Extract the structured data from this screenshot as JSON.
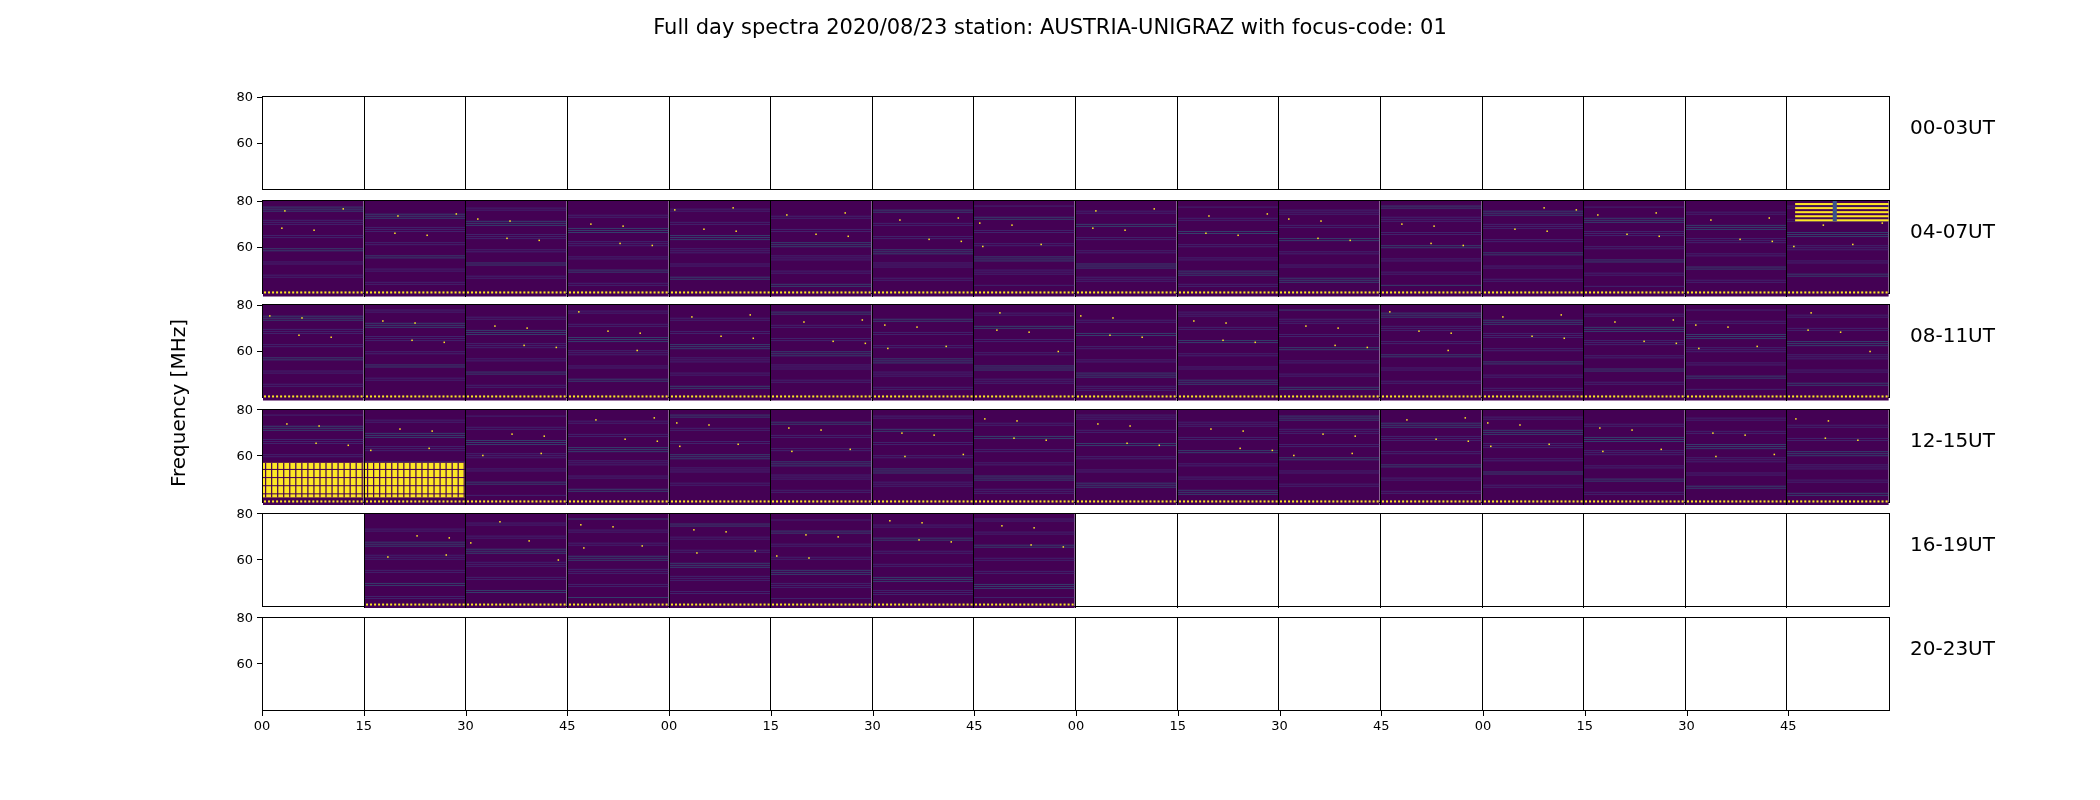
{
  "title": "Full day spectra 2020/08/23 station: AUSTRIA-UNIGRAZ with focus-code: 01",
  "ylabel": "Frequency [MHz]",
  "xticks": [
    "00",
    "15",
    "30",
    "45",
    "00",
    "15",
    "30",
    "45",
    "00",
    "15",
    "30",
    "45",
    "00",
    "15",
    "30",
    "45"
  ],
  "rows": [
    {
      "label": "00-03UT",
      "yticks": [
        "80",
        "60"
      ],
      "panels": [
        {
          "kind": "empty"
        },
        {
          "kind": "empty"
        },
        {
          "kind": "empty"
        },
        {
          "kind": "empty"
        },
        {
          "kind": "empty"
        },
        {
          "kind": "empty"
        },
        {
          "kind": "empty"
        },
        {
          "kind": "empty"
        },
        {
          "kind": "empty"
        },
        {
          "kind": "empty"
        },
        {
          "kind": "empty"
        },
        {
          "kind": "empty"
        },
        {
          "kind": "empty"
        },
        {
          "kind": "empty"
        },
        {
          "kind": "empty"
        },
        {
          "kind": "empty"
        }
      ]
    },
    {
      "label": "04-07UT",
      "yticks": [
        "80",
        "60"
      ],
      "panels": [
        {
          "kind": "spectrum"
        },
        {
          "kind": "spectrum"
        },
        {
          "kind": "spectrum"
        },
        {
          "kind": "spectrum"
        },
        {
          "kind": "spectrum"
        },
        {
          "kind": "spectrum"
        },
        {
          "kind": "spectrum"
        },
        {
          "kind": "spectrum"
        },
        {
          "kind": "spectrum"
        },
        {
          "kind": "spectrum"
        },
        {
          "kind": "spectrum"
        },
        {
          "kind": "spectrum"
        },
        {
          "kind": "spectrum"
        },
        {
          "kind": "spectrum"
        },
        {
          "kind": "spectrum"
        },
        {
          "kind": "saturated-high"
        }
      ]
    },
    {
      "label": "08-11UT",
      "yticks": [
        "80",
        "60"
      ],
      "panels": [
        {
          "kind": "spectrum"
        },
        {
          "kind": "spectrum"
        },
        {
          "kind": "spectrum"
        },
        {
          "kind": "spectrum"
        },
        {
          "kind": "spectrum"
        },
        {
          "kind": "spectrum"
        },
        {
          "kind": "spectrum"
        },
        {
          "kind": "spectrum"
        },
        {
          "kind": "spectrum"
        },
        {
          "kind": "spectrum"
        },
        {
          "kind": "spectrum"
        },
        {
          "kind": "spectrum"
        },
        {
          "kind": "spectrum"
        },
        {
          "kind": "spectrum"
        },
        {
          "kind": "spectrum"
        },
        {
          "kind": "spectrum"
        }
      ]
    },
    {
      "label": "12-15UT",
      "yticks": [
        "80",
        "60"
      ],
      "panels": [
        {
          "kind": "saturated-low"
        },
        {
          "kind": "saturated-low"
        },
        {
          "kind": "spectrum"
        },
        {
          "kind": "spectrum"
        },
        {
          "kind": "spectrum"
        },
        {
          "kind": "spectrum"
        },
        {
          "kind": "spectrum"
        },
        {
          "kind": "spectrum"
        },
        {
          "kind": "spectrum"
        },
        {
          "kind": "spectrum"
        },
        {
          "kind": "spectrum"
        },
        {
          "kind": "spectrum"
        },
        {
          "kind": "spectrum"
        },
        {
          "kind": "spectrum"
        },
        {
          "kind": "spectrum"
        },
        {
          "kind": "spectrum"
        }
      ]
    },
    {
      "label": "16-19UT",
      "yticks": [
        "80",
        "60"
      ],
      "panels": [
        {
          "kind": "empty"
        },
        {
          "kind": "spectrum"
        },
        {
          "kind": "spectrum"
        },
        {
          "kind": "spectrum"
        },
        {
          "kind": "spectrum"
        },
        {
          "kind": "spectrum"
        },
        {
          "kind": "spectrum"
        },
        {
          "kind": "spectrum"
        },
        {
          "kind": "empty"
        },
        {
          "kind": "empty"
        },
        {
          "kind": "empty"
        },
        {
          "kind": "empty"
        },
        {
          "kind": "empty"
        },
        {
          "kind": "empty"
        },
        {
          "kind": "empty"
        },
        {
          "kind": "empty"
        }
      ]
    },
    {
      "label": "20-23UT",
      "yticks": [
        "80",
        "60"
      ],
      "panels": [
        {
          "kind": "empty"
        },
        {
          "kind": "empty"
        },
        {
          "kind": "empty"
        },
        {
          "kind": "empty"
        },
        {
          "kind": "empty"
        },
        {
          "kind": "empty"
        },
        {
          "kind": "empty"
        },
        {
          "kind": "empty"
        },
        {
          "kind": "empty"
        },
        {
          "kind": "empty"
        },
        {
          "kind": "empty"
        },
        {
          "kind": "empty"
        },
        {
          "kind": "empty"
        },
        {
          "kind": "empty"
        },
        {
          "kind": "empty"
        },
        {
          "kind": "empty"
        }
      ]
    }
  ]
}
